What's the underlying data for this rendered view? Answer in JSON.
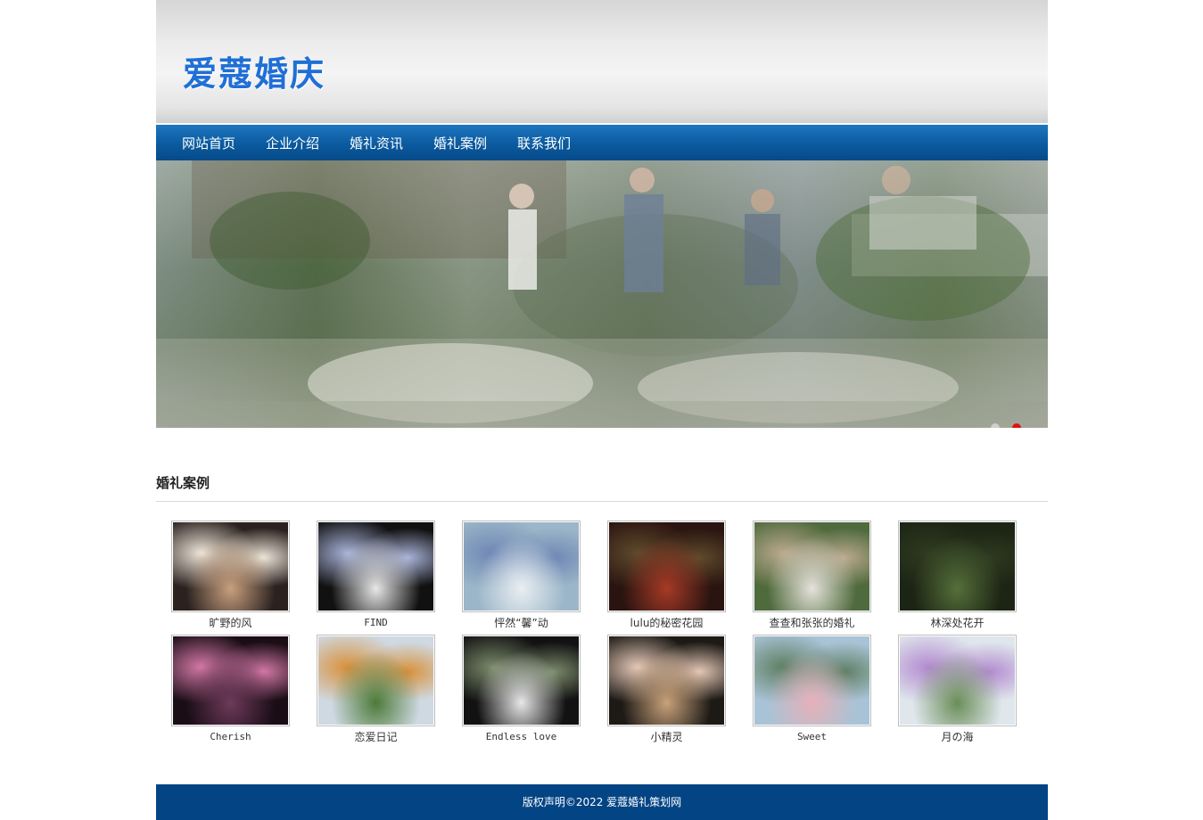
{
  "header": {
    "logo": "爱蔻婚庆"
  },
  "nav": {
    "items": [
      {
        "label": "网站首页"
      },
      {
        "label": "企业介绍"
      },
      {
        "label": "婚礼资讯"
      },
      {
        "label": "婚礼案例"
      },
      {
        "label": "联系我们"
      }
    ]
  },
  "banner": {
    "slide_count": 2,
    "active_slide": 2
  },
  "cases": {
    "title": "婚礼案例",
    "items": [
      {
        "label": "旷野的风",
        "colors": [
          "#2b2220",
          "#c9a07e",
          "#efe7da"
        ]
      },
      {
        "label": "FIND",
        "colors": [
          "#111111",
          "#e8e8e8",
          "#a8b2d8"
        ]
      },
      {
        "label": "怦然“馨”动",
        "colors": [
          "#9bb6c8",
          "#e9eef2",
          "#6f87b5"
        ]
      },
      {
        "label": "lulu的秘密花园",
        "colors": [
          "#2a1410",
          "#a63a26",
          "#5f4a2c"
        ]
      },
      {
        "label": "查查和张张的婚礼",
        "colors": [
          "#4f6a3c",
          "#e6e3dc",
          "#bba98f"
        ]
      },
      {
        "label": "林深处花开",
        "colors": [
          "#1c2414",
          "#55703a",
          "#2e3a20"
        ]
      },
      {
        "label": "Cherish",
        "colors": [
          "#1a0d16",
          "#6d3a5a",
          "#d67aa8"
        ]
      },
      {
        "label": "恋爱日记",
        "colors": [
          "#cfd9e2",
          "#4c7a38",
          "#d9913c"
        ]
      },
      {
        "label": "Endless love",
        "colors": [
          "#121212",
          "#e8e8e8",
          "#7a8a6a"
        ]
      },
      {
        "label": "小精灵",
        "colors": [
          "#1d1a16",
          "#c9a27a",
          "#e6c9b8"
        ]
      },
      {
        "label": "Sweet",
        "colors": [
          "#a9c3d6",
          "#e6b0b8",
          "#5f7f63"
        ]
      },
      {
        "label": "月の海",
        "colors": [
          "#dfe6ec",
          "#6a8d58",
          "#b38ad0"
        ]
      }
    ]
  },
  "footer": {
    "text": "版权声明©2022 爱蔻婚礼策划网"
  },
  "colors": {
    "nav": "#0b5a9f",
    "footer": "#034484",
    "logo": "#1f6fd6",
    "dot_active": "#e01010"
  }
}
